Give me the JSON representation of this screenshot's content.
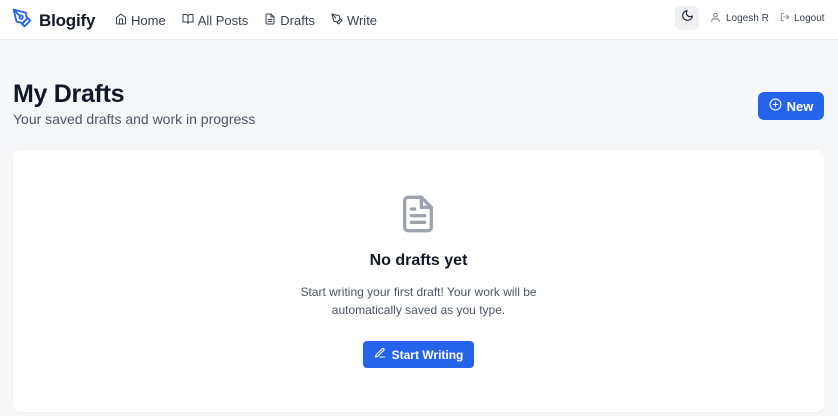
{
  "brand": {
    "name": "Blogify",
    "icon": "pen-nib-icon",
    "color": "#2563eb"
  },
  "nav": {
    "items": [
      {
        "label": "Home",
        "icon": "home-icon"
      },
      {
        "label": "All Posts",
        "icon": "book-open-icon"
      },
      {
        "label": "Drafts",
        "icon": "file-text-icon"
      },
      {
        "label": "Write",
        "icon": "pen-icon"
      }
    ]
  },
  "topbar": {
    "theme_icon": "moon-icon",
    "user_name": "Logesh R",
    "user_icon": "user-icon",
    "logout_label": "Logout",
    "logout_icon": "log-out-icon"
  },
  "header": {
    "title": "My Drafts",
    "subtitle": "Your saved drafts and work in progress",
    "new_button_label": "New",
    "new_button_icon": "plus-circle-icon"
  },
  "empty_state": {
    "icon": "file-text-icon",
    "title": "No drafts yet",
    "message": "Start writing your first draft! Your work will be automatically saved as you type.",
    "button_label": "Start Writing",
    "button_icon": "pencil-icon"
  },
  "colors": {
    "accent": "#2563eb",
    "background": "#f6f7f9",
    "card": "#ffffff",
    "text": "#111827",
    "muted_text": "#4b5563"
  }
}
